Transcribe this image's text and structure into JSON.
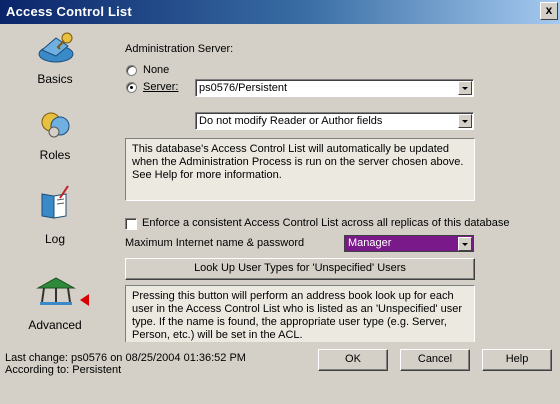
{
  "window": {
    "title": "Access Control List",
    "close_label": "x"
  },
  "sidebar": {
    "items": [
      {
        "label": "Basics",
        "icon": "key-icon"
      },
      {
        "label": "Roles",
        "icon": "roles-icon"
      },
      {
        "label": "Log",
        "icon": "log-book-icon"
      },
      {
        "label": "Advanced",
        "icon": "advanced-icon"
      }
    ]
  },
  "main": {
    "admin_server_label": "Administration Server:",
    "radio_none": "None",
    "radio_server": "Server:",
    "server_value": "ps0576/Persistent",
    "modify_option": "Do not modify Reader or Author fields",
    "info_text_1": "This database's Access Control List will automatically be updated when the Administration Process is run on the server chosen above. See Help for more information.",
    "enforce_label": "Enforce a consistent Access Control List across all replicas of this database",
    "max_internet_label": "Maximum Internet name & password",
    "max_internet_value": "Manager",
    "lookup_button": "Look Up User Types for 'Unspecified' Users",
    "info_text_2": "Pressing this button will perform an address book look up for each user in the Access Control List who is listed as an 'Unspecified' user type.  If the name is found, the appropriate user type (e.g. Server, Person, etc.) will be set in the ACL."
  },
  "footer": {
    "last_change": "Last change: ps0576 on 08/25/2004 01:36:52 PM",
    "according_to": "According to: Persistent",
    "ok_label": "OK",
    "cancel_label": "Cancel",
    "help_label": "Help"
  },
  "colors": {
    "titlebar_start": "#0a246a",
    "titlebar_end": "#a6caf0",
    "dialog_face": "#d4d0c8",
    "selected_option": "#7a1a8a",
    "indicator_arrow": "#d80000"
  }
}
